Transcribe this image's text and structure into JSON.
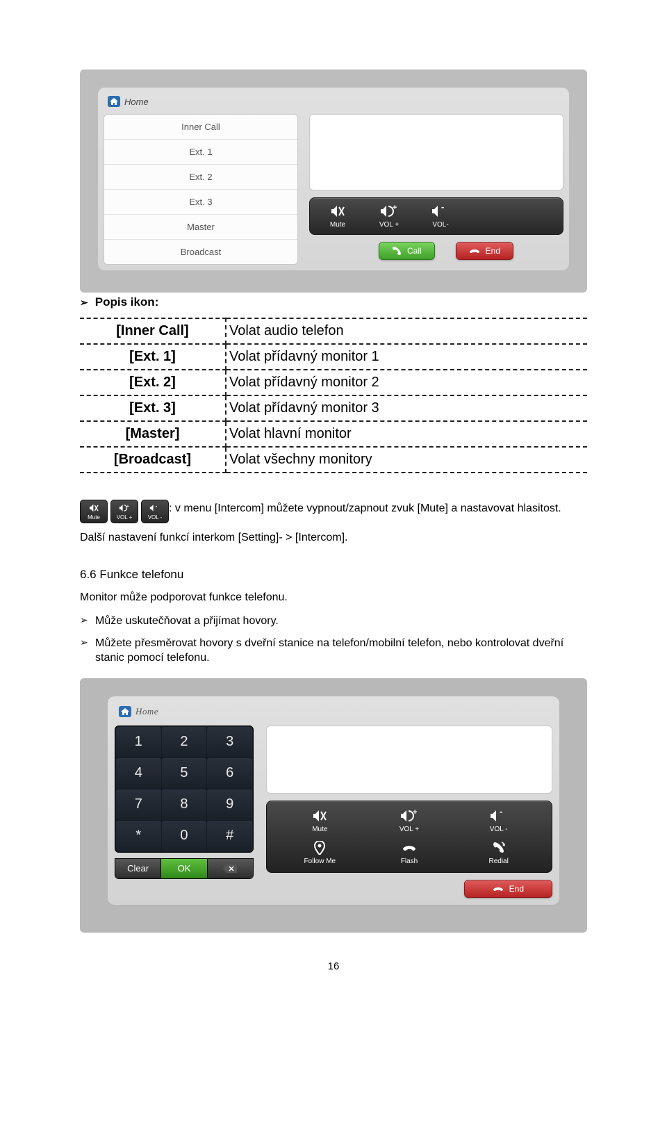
{
  "screenshot1": {
    "home_label": "Home",
    "call_list": [
      "Inner Call",
      "Ext. 1",
      "Ext. 2",
      "Ext. 3",
      "Master",
      "Broadcast"
    ],
    "vol_bar": {
      "mute": "Mute",
      "vol_up": "VOL +",
      "vol_down": "VOL-"
    },
    "btn_call": "Call",
    "btn_end": "End"
  },
  "popis_ikon_heading": "Popis ikon:",
  "icon_table": [
    {
      "key": "[Inner Call]",
      "val": "Volat audio telefon"
    },
    {
      "key": "[Ext. 1]",
      "val": "Volat přídavný monitor 1"
    },
    {
      "key": "[Ext. 2]",
      "val": "Volat přídavný monitor 2"
    },
    {
      "key": "[Ext. 3]",
      "val": "Volat přídavný monitor 3"
    },
    {
      "key": "[Master]",
      "val": "Volat hlavní monitor"
    },
    {
      "key": "[Broadcast]",
      "val": "Volat všechny monitory"
    }
  ],
  "mini_strip": {
    "mute": "Mute",
    "volp": "VOL +",
    "volm": "VOL -"
  },
  "strip_text": ": v menu [Intercom] můžete vypnout/zapnout zvuk [Mute] a nastavovat hlasitost.",
  "strip_text2": "Další nastavení funkcí interkom [Setting]- > [Intercom].",
  "section66_title": "6.6 Funkce telefonu",
  "section66_intro": "Monitor může podporovat funkce telefonu.",
  "bullets": [
    "Může uskutečňovat a přijímat hovory.",
    "Můžete přesměrovat hovory s dveřní stanice na telefon/mobilní telefon, nebo kontrolovat dveřní stanic pomocí telefonu."
  ],
  "screenshot2": {
    "home_label": "Home",
    "keys": [
      "1",
      "2",
      "3",
      "4",
      "5",
      "6",
      "7",
      "8",
      "9",
      "*",
      "0",
      "#"
    ],
    "clear": "Clear",
    "ok": "OK",
    "controls": {
      "mute": "Mute",
      "volp": "VOL +",
      "volm": "VOL -",
      "follow": "Follow Me",
      "flash": "Flash",
      "redial": "Redial"
    },
    "end": "End"
  },
  "page_number": "16"
}
